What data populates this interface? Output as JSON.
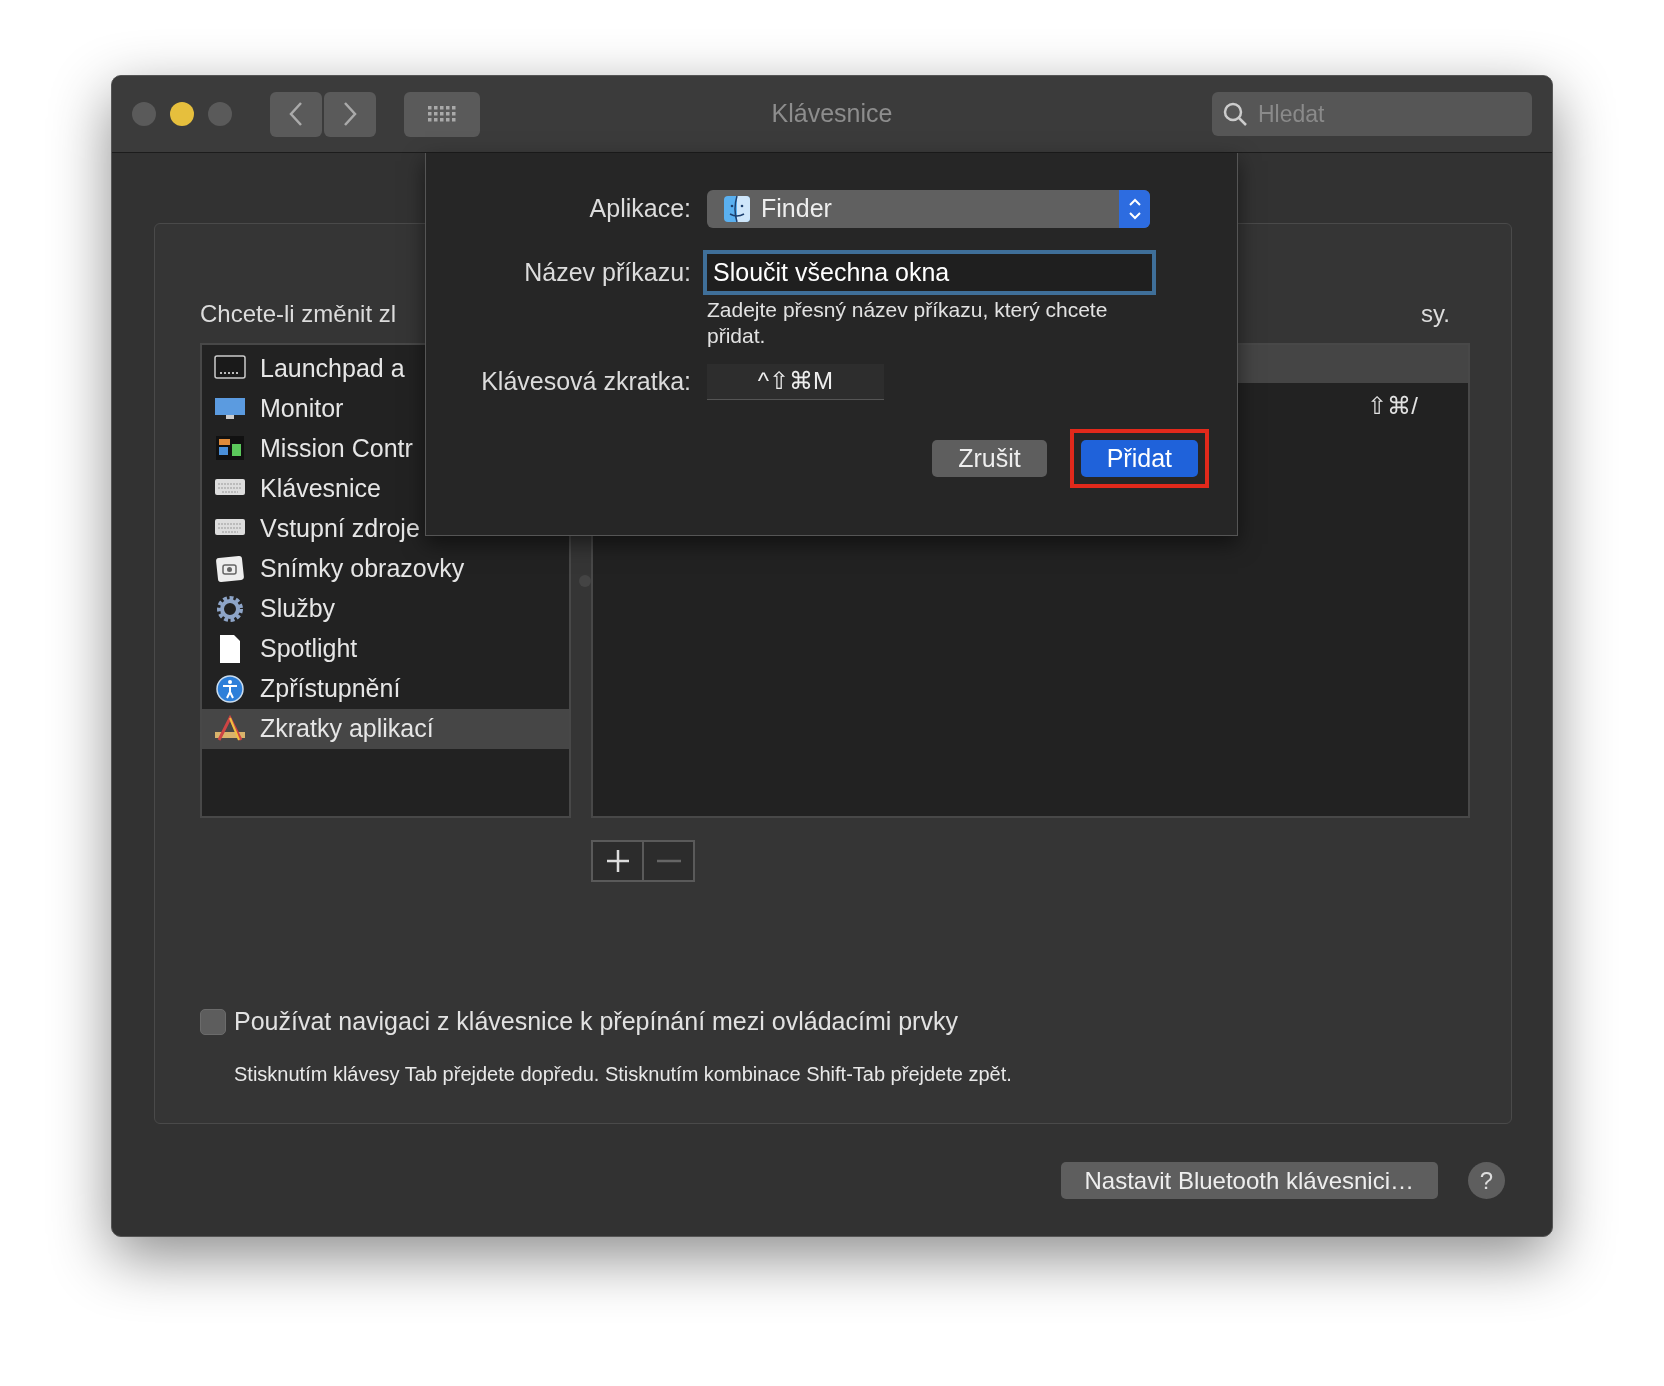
{
  "window": {
    "title": "Klávesnice",
    "search": {
      "placeholder": "Hledat"
    }
  },
  "panel": {
    "instruction": "Chcete-li změnit zl",
    "instruction_end": "sy.",
    "categories": [
      {
        "label": "Launchpad a",
        "selected": false
      },
      {
        "label": "Monitor",
        "selected": false
      },
      {
        "label": "Mission Contr",
        "selected": false
      },
      {
        "label": "Klávesnice",
        "selected": false
      },
      {
        "label": "Vstupní zdroje",
        "selected": false
      },
      {
        "label": "Snímky obrazovky",
        "selected": false
      },
      {
        "label": "Služby",
        "selected": false
      },
      {
        "label": "Spotlight",
        "selected": false
      },
      {
        "label": "Zpřístupnění",
        "selected": false
      },
      {
        "label": "Zkratky aplikací",
        "selected": true
      }
    ],
    "shortcut_rows": [
      {
        "shortcut": "⇧⌘/"
      }
    ],
    "keyboard_navigation": {
      "label": "Používat navigaci z klávesnice k přepínání mezi ovládacími prvky",
      "checked": false,
      "hint": "Stisknutím klávesy Tab přejdete dopředu. Stisknutím kombinace Shift-Tab přejdete zpět."
    }
  },
  "bluetooth_button": "Nastavit Bluetooth klávesnici…",
  "help_button": "?",
  "sheet": {
    "fields": [
      {
        "kind": "popup",
        "label": "Aplikace:",
        "value": "Finder"
      },
      {
        "kind": "text",
        "label": "Název příkazu:",
        "value": "Sloučit všechna okna",
        "hint": "Zadejte přesný název příkazu, který chcete přidat."
      },
      {
        "kind": "shortcut",
        "label": "Klávesová zkratka:",
        "value": "^⇧⌘M"
      }
    ],
    "buttons": [
      {
        "label": "Zrušit",
        "default": false,
        "highlighted": false
      },
      {
        "label": "Přidat",
        "default": true,
        "highlighted": true
      }
    ]
  }
}
